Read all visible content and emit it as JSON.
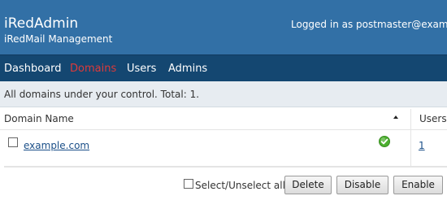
{
  "header": {
    "title": "iRedAdmin",
    "subtitle": "iRedMail Management",
    "login_info": "Logged in as postmaster@example.com"
  },
  "nav": {
    "items": [
      {
        "label": "Dashboard",
        "active": false
      },
      {
        "label": "Domains",
        "active": true
      },
      {
        "label": "Users",
        "active": false
      },
      {
        "label": "Admins",
        "active": false
      }
    ]
  },
  "info": {
    "text": "All domains under your control. Total: 1."
  },
  "table": {
    "columns": [
      "Domain Name",
      "Users"
    ],
    "sort": "ascending",
    "rows": [
      {
        "domain": "example.com",
        "status": "active",
        "users": "1"
      }
    ]
  },
  "actions": {
    "select_all_label": "Select/Unselect all",
    "delete_label": "Delete",
    "disable_label": "Disable",
    "enable_label": "Enable"
  },
  "colors": {
    "header_bg": "#3270a6",
    "nav_bg": "#144771",
    "nav_active": "#dc3a3a",
    "info_bg": "#e7ecf1",
    "link": "#1b4f88",
    "status_ok": "#4caf2f"
  },
  "icons": {
    "status": "check-circle-icon",
    "sort": "sort-ascending-icon"
  }
}
